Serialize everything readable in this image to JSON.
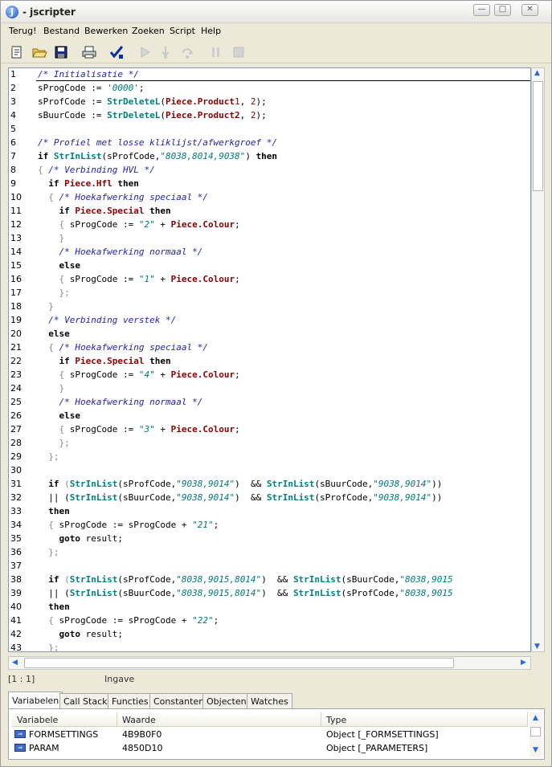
{
  "window": {
    "title": "- jscripter",
    "app_icon": "J"
  },
  "menu": [
    "Terug!",
    "Bestand",
    "Bewerken",
    "Zoeken",
    "Script",
    "Help"
  ],
  "toolbar_icons": [
    "new-file-icon",
    "open-folder-icon",
    "save-icon",
    "print-icon",
    "check-syntax-icon",
    "run-icon",
    "step-into-icon",
    "step-over-icon",
    "pause-icon",
    "stop-icon"
  ],
  "editor": {
    "lines": [
      {
        "n": "1",
        "c": [
          [
            "cm",
            "/* Initialisatie */"
          ]
        ]
      },
      {
        "n": "2",
        "c": [
          [
            "",
            "sProgCode := "
          ],
          [
            "st",
            "'0000'"
          ],
          [
            "",
            ";"
          ]
        ]
      },
      {
        "n": "3",
        "c": [
          [
            "",
            "sProfCode := "
          ],
          [
            "fn",
            "StrDeleteL"
          ],
          [
            "",
            "("
          ],
          [
            "ob",
            "Piece.Product"
          ],
          [
            "nm",
            "1"
          ],
          [
            "",
            ", "
          ],
          [
            "nm",
            "2"
          ],
          [
            "",
            ");"
          ]
        ]
      },
      {
        "n": "4",
        "c": [
          [
            "",
            "sBuurCode := "
          ],
          [
            "fn",
            "StrDeleteL"
          ],
          [
            "",
            "("
          ],
          [
            "ob",
            "Piece.Product2"
          ],
          [
            "",
            ", "
          ],
          [
            "nm",
            "2"
          ],
          [
            "",
            ");"
          ]
        ]
      },
      {
        "n": "5",
        "c": []
      },
      {
        "n": "6",
        "c": [
          [
            "cm",
            "/* Profiel met losse kliklijst/afwerkgroef */"
          ]
        ]
      },
      {
        "n": "7",
        "c": [
          [
            "kw",
            "if "
          ],
          [
            "fn",
            "StrInList"
          ],
          [
            "",
            "(sProfCode,"
          ],
          [
            "st",
            "\"8038,8014,9038\""
          ],
          [
            "",
            ") "
          ],
          [
            "kw",
            "then"
          ]
        ]
      },
      {
        "n": "8",
        "c": [
          [
            "br",
            "{ "
          ],
          [
            "cm",
            "/* Verbinding HVL */"
          ]
        ]
      },
      {
        "n": "9",
        "c": [
          [
            "",
            "  "
          ],
          [
            "kw",
            "if "
          ],
          [
            "ob",
            "Piece.Hfl"
          ],
          [
            "kw",
            " then"
          ]
        ]
      },
      {
        "n": "10",
        "c": [
          [
            "br",
            "  { "
          ],
          [
            "cm",
            "/* Hoekafwerking speciaal */"
          ]
        ]
      },
      {
        "n": "11",
        "c": [
          [
            "",
            "    "
          ],
          [
            "kw",
            "if "
          ],
          [
            "ob",
            "Piece.Special"
          ],
          [
            "kw",
            " then"
          ]
        ]
      },
      {
        "n": "12",
        "c": [
          [
            "br",
            "    { "
          ],
          [
            "",
            "sProgCode := "
          ],
          [
            "st",
            "\"2\""
          ],
          [
            "",
            " + "
          ],
          [
            "ob",
            "Piece.Colour"
          ],
          [
            "",
            ";"
          ]
        ]
      },
      {
        "n": "13",
        "c": [
          [
            "br",
            "    }"
          ]
        ]
      },
      {
        "n": "14",
        "c": [
          [
            "",
            "    "
          ],
          [
            "cm",
            "/* Hoekafwerking normaal */"
          ]
        ]
      },
      {
        "n": "15",
        "c": [
          [
            "",
            "    "
          ],
          [
            "kw",
            "else"
          ]
        ]
      },
      {
        "n": "16",
        "c": [
          [
            "br",
            "    { "
          ],
          [
            "",
            "sProgCode := "
          ],
          [
            "st",
            "\"1\""
          ],
          [
            "",
            " + "
          ],
          [
            "ob",
            "Piece.Colour"
          ],
          [
            "",
            ";"
          ]
        ]
      },
      {
        "n": "17",
        "c": [
          [
            "br",
            "    };"
          ]
        ]
      },
      {
        "n": "18",
        "c": [
          [
            "br",
            "  }"
          ]
        ]
      },
      {
        "n": "19",
        "c": [
          [
            "",
            "  "
          ],
          [
            "cm",
            "/* Verbinding verstek */"
          ]
        ]
      },
      {
        "n": "20",
        "c": [
          [
            "",
            "  "
          ],
          [
            "kw",
            "else"
          ]
        ]
      },
      {
        "n": "21",
        "c": [
          [
            "br",
            "  { "
          ],
          [
            "cm",
            "/* Hoekafwerking speciaal */"
          ]
        ]
      },
      {
        "n": "22",
        "c": [
          [
            "",
            "    "
          ],
          [
            "kw",
            "if "
          ],
          [
            "ob",
            "Piece.Special"
          ],
          [
            "kw",
            " then"
          ]
        ]
      },
      {
        "n": "23",
        "c": [
          [
            "br",
            "    { "
          ],
          [
            "",
            "sProgCode := "
          ],
          [
            "st",
            "\"4\""
          ],
          [
            "",
            " + "
          ],
          [
            "ob",
            "Piece.Colour"
          ],
          [
            "",
            ";"
          ]
        ]
      },
      {
        "n": "24",
        "c": [
          [
            "br",
            "    }"
          ]
        ]
      },
      {
        "n": "25",
        "c": [
          [
            "",
            "    "
          ],
          [
            "cm",
            "/* Hoekafwerking normaal */"
          ]
        ]
      },
      {
        "n": "26",
        "c": [
          [
            "",
            "    "
          ],
          [
            "kw",
            "else"
          ]
        ]
      },
      {
        "n": "27",
        "c": [
          [
            "br",
            "    { "
          ],
          [
            "",
            "sProgCode := "
          ],
          [
            "st",
            "\"3\""
          ],
          [
            "",
            " + "
          ],
          [
            "ob",
            "Piece.Colour"
          ],
          [
            "",
            ";"
          ]
        ]
      },
      {
        "n": "28",
        "c": [
          [
            "br",
            "    };"
          ]
        ]
      },
      {
        "n": "29",
        "c": [
          [
            "br",
            "  };"
          ]
        ]
      },
      {
        "n": "30",
        "c": []
      },
      {
        "n": "31",
        "c": [
          [
            "",
            "  "
          ],
          [
            "kw",
            "if "
          ],
          [
            "br",
            "("
          ],
          [
            "fn",
            "StrInList"
          ],
          [
            "",
            "(sProfCode,"
          ],
          [
            "st",
            "\"9038,9014\""
          ],
          [
            "",
            ")  && "
          ],
          [
            "fn",
            "StrInList"
          ],
          [
            "",
            "(sBuurCode,"
          ],
          [
            "st",
            "\"9038,9014\""
          ],
          [
            "",
            "))"
          ]
        ]
      },
      {
        "n": "32",
        "c": [
          [
            "",
            "  || ("
          ],
          [
            "fn",
            "StrInList"
          ],
          [
            "",
            "(sBuurCode,"
          ],
          [
            "st",
            "\"9038,9014\""
          ],
          [
            "",
            ")  && "
          ],
          [
            "fn",
            "StrInList"
          ],
          [
            "",
            "(sProfCode,"
          ],
          [
            "st",
            "\"9038,9014\""
          ],
          [
            "",
            "))"
          ]
        ]
      },
      {
        "n": "33",
        "c": [
          [
            "",
            "  "
          ],
          [
            "kw",
            "then"
          ]
        ]
      },
      {
        "n": "34",
        "c": [
          [
            "br",
            "  { "
          ],
          [
            "",
            "sProgCode := sProgCode + "
          ],
          [
            "st",
            "\"21\""
          ],
          [
            "",
            ";"
          ]
        ]
      },
      {
        "n": "35",
        "c": [
          [
            "",
            "    "
          ],
          [
            "kw",
            "goto"
          ],
          [
            "",
            " result;"
          ]
        ]
      },
      {
        "n": "36",
        "c": [
          [
            "br",
            "  };"
          ]
        ]
      },
      {
        "n": "37",
        "c": []
      },
      {
        "n": "38",
        "c": [
          [
            "",
            "  "
          ],
          [
            "kw",
            "if "
          ],
          [
            "br",
            "("
          ],
          [
            "fn",
            "StrInList"
          ],
          [
            "",
            "(sProfCode,"
          ],
          [
            "st",
            "\"8038,9015,8014\""
          ],
          [
            "",
            ")  && "
          ],
          [
            "fn",
            "StrInList"
          ],
          [
            "",
            "(sBuurCode,"
          ],
          [
            "st",
            "\"8038,9015"
          ]
        ]
      },
      {
        "n": "39",
        "c": [
          [
            "",
            "  || ("
          ],
          [
            "fn",
            "StrInList"
          ],
          [
            "",
            "(sBuurCode,"
          ],
          [
            "st",
            "\"8038,9015,8014\""
          ],
          [
            "",
            ")  && "
          ],
          [
            "fn",
            "StrInList"
          ],
          [
            "",
            "(sProfCode,"
          ],
          [
            "st",
            "\"8038,9015"
          ]
        ]
      },
      {
        "n": "40",
        "c": [
          [
            "",
            "  "
          ],
          [
            "kw",
            "then"
          ]
        ]
      },
      {
        "n": "41",
        "c": [
          [
            "br",
            "  { "
          ],
          [
            "",
            "sProgCode := sProgCode + "
          ],
          [
            "st",
            "\"22\""
          ],
          [
            "",
            ";"
          ]
        ]
      },
      {
        "n": "42",
        "c": [
          [
            "",
            "    "
          ],
          [
            "kw",
            "goto"
          ],
          [
            "",
            " result;"
          ]
        ]
      },
      {
        "n": "43",
        "c": [
          [
            "br",
            "  };"
          ]
        ]
      }
    ]
  },
  "status": {
    "position": "[1 : 1]",
    "mode": "Ingave"
  },
  "tabs": [
    {
      "label": "Variabelen",
      "active": true
    },
    {
      "label": "Call Stack",
      "active": false
    },
    {
      "label": "Functies",
      "active": false
    },
    {
      "label": "Constanten",
      "active": false
    },
    {
      "label": "Objecten",
      "active": false
    },
    {
      "label": "Watches",
      "active": false
    }
  ],
  "variables": {
    "columns": [
      "Variabele",
      "Waarde",
      "Type"
    ],
    "rows": [
      {
        "name": "FORMSETTINGS",
        "value": "4B9B0F0",
        "type": "Object [_FORMSETTINGS]"
      },
      {
        "name": "PARAM",
        "value": "4850D10",
        "type": "Object [_PARAMETERS]"
      }
    ]
  },
  "colors": {
    "comment": "#1f1fb5",
    "string": "#007a7a",
    "function": "#008080",
    "object": "#8b0000",
    "accent": "#2b6ad6"
  }
}
